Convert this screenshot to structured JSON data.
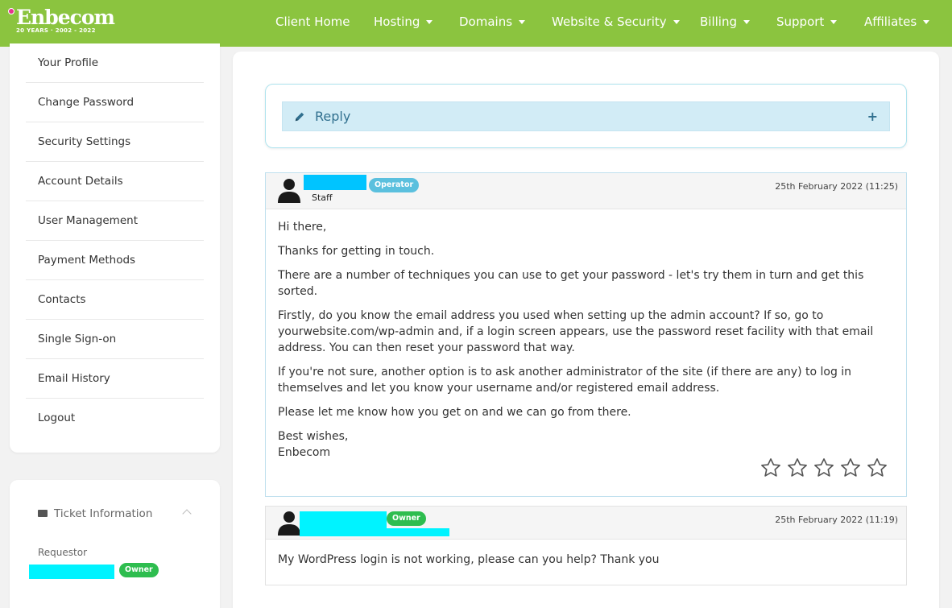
{
  "logo": {
    "name": "Enbecom",
    "tagline": "20 YEARS · 2002 - 2022"
  },
  "nav": [
    {
      "label": "Client Home"
    },
    {
      "label": "Hosting"
    },
    {
      "label": "Domains"
    },
    {
      "label": "Website & Security"
    },
    {
      "label": "Billing"
    },
    {
      "label": "Support"
    },
    {
      "label": "Affiliates"
    }
  ],
  "sidebar": {
    "items": [
      {
        "label": "Your Profile"
      },
      {
        "label": "Change Password"
      },
      {
        "label": "Security Settings"
      },
      {
        "label": "Account Details"
      },
      {
        "label": "User Management"
      },
      {
        "label": "Payment Methods"
      },
      {
        "label": "Contacts"
      },
      {
        "label": "Single Sign-on"
      },
      {
        "label": "Email History"
      },
      {
        "label": "Logout"
      }
    ],
    "ticket_info": {
      "title": "Ticket Information",
      "requestor_label": "Requestor",
      "owner_badge": "Owner"
    }
  },
  "reply": {
    "label": "Reply",
    "plus": "+"
  },
  "messages": [
    {
      "badge": "Operator",
      "role": "Staff",
      "date": "25th February 2022 (11:25)",
      "paragraphs": [
        "Hi there,",
        "Thanks for getting in touch.",
        "There are a number of techniques you can use to get your password - let's try them in turn and get this sorted.",
        "Firstly, do you know the email address you used when setting up the admin account? If so, go to yourwebsite.com/wp-admin and, if a login screen appears, use the password reset facility with that email address. You can then reset your password that way.",
        "If you're not sure, another option is to ask another administrator of the site (if there are any) to log in themselves and let you know your username and/or registered email address.",
        "Please let me know how you get on and we can go from there.",
        "Best wishes,",
        "Enbecom"
      ],
      "rating": 0
    },
    {
      "badge": "Owner",
      "date": "25th February 2022 (11:19)",
      "body": "My WordPress login is not working, please can you help? Thank you"
    }
  ],
  "colors": {
    "nav_green": "#8bc43f",
    "redaction": "#00f3ff",
    "operator": "#5bc0de",
    "owner": "#2ebd4f"
  }
}
